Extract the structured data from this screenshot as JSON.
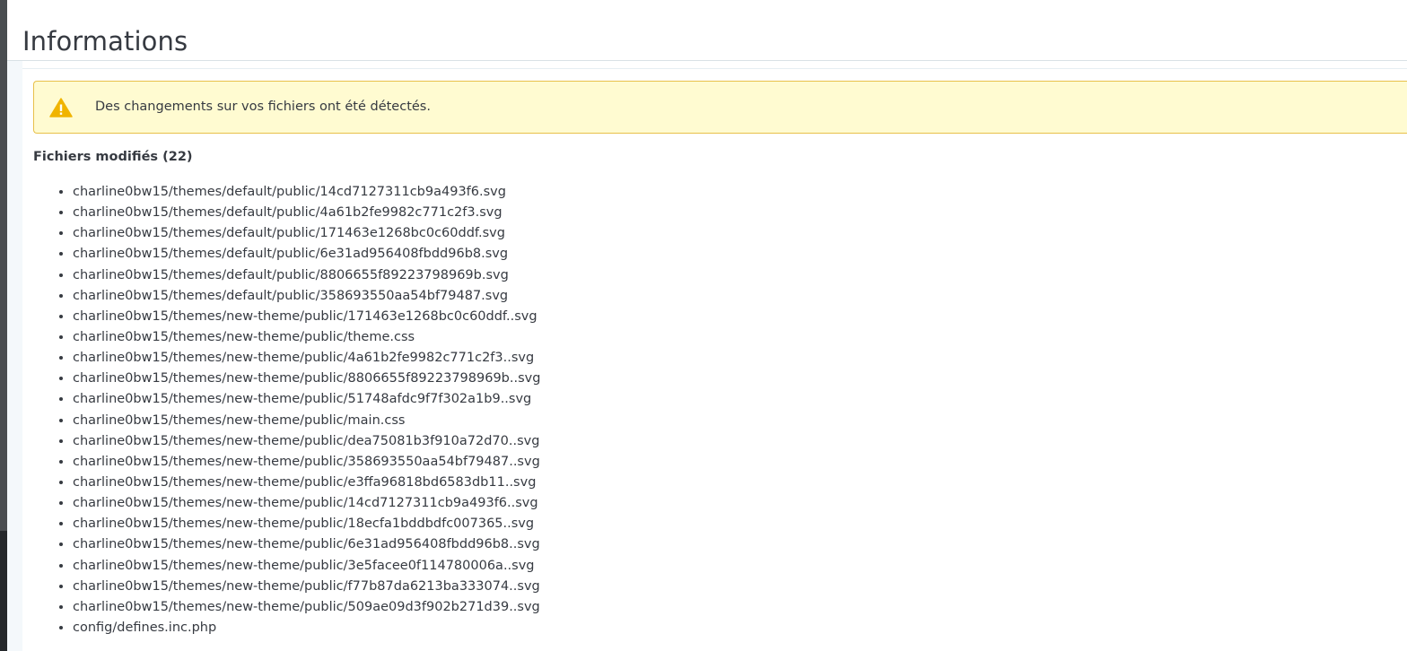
{
  "page": {
    "title": "Informations"
  },
  "alert": {
    "icon": "warning-icon",
    "message": "Des changements sur vos fichiers ont été détectés.",
    "accent_color": "#f0b400",
    "background_color": "#fffbd1"
  },
  "modified_files": {
    "heading": "Fichiers modifiés (22)",
    "items": [
      "charline0bw15/themes/default/public/14cd7127311cb9a493f6.svg",
      "charline0bw15/themes/default/public/4a61b2fe9982c771c2f3.svg",
      "charline0bw15/themes/default/public/171463e1268bc0c60ddf.svg",
      "charline0bw15/themes/default/public/6e31ad956408fbdd96b8.svg",
      "charline0bw15/themes/default/public/8806655f89223798969b.svg",
      "charline0bw15/themes/default/public/358693550aa54bf79487.svg",
      "charline0bw15/themes/new-theme/public/171463e1268bc0c60ddf..svg",
      "charline0bw15/themes/new-theme/public/theme.css",
      "charline0bw15/themes/new-theme/public/4a61b2fe9982c771c2f3..svg",
      "charline0bw15/themes/new-theme/public/8806655f89223798969b..svg",
      "charline0bw15/themes/new-theme/public/51748afdc9f7f302a1b9..svg",
      "charline0bw15/themes/new-theme/public/main.css",
      "charline0bw15/themes/new-theme/public/dea75081b3f910a72d70..svg",
      "charline0bw15/themes/new-theme/public/358693550aa54bf79487..svg",
      "charline0bw15/themes/new-theme/public/e3ffa96818bd6583db11..svg",
      "charline0bw15/themes/new-theme/public/14cd7127311cb9a493f6..svg",
      "charline0bw15/themes/new-theme/public/18ecfa1bddbdfc007365..svg",
      "charline0bw15/themes/new-theme/public/6e31ad956408fbdd96b8..svg",
      "charline0bw15/themes/new-theme/public/3e5facee0f114780006a..svg",
      "charline0bw15/themes/new-theme/public/f77b87da6213ba333074..svg",
      "charline0bw15/themes/new-theme/public/509ae09d3f902b271d39..svg",
      "config/defines.inc.php"
    ]
  }
}
